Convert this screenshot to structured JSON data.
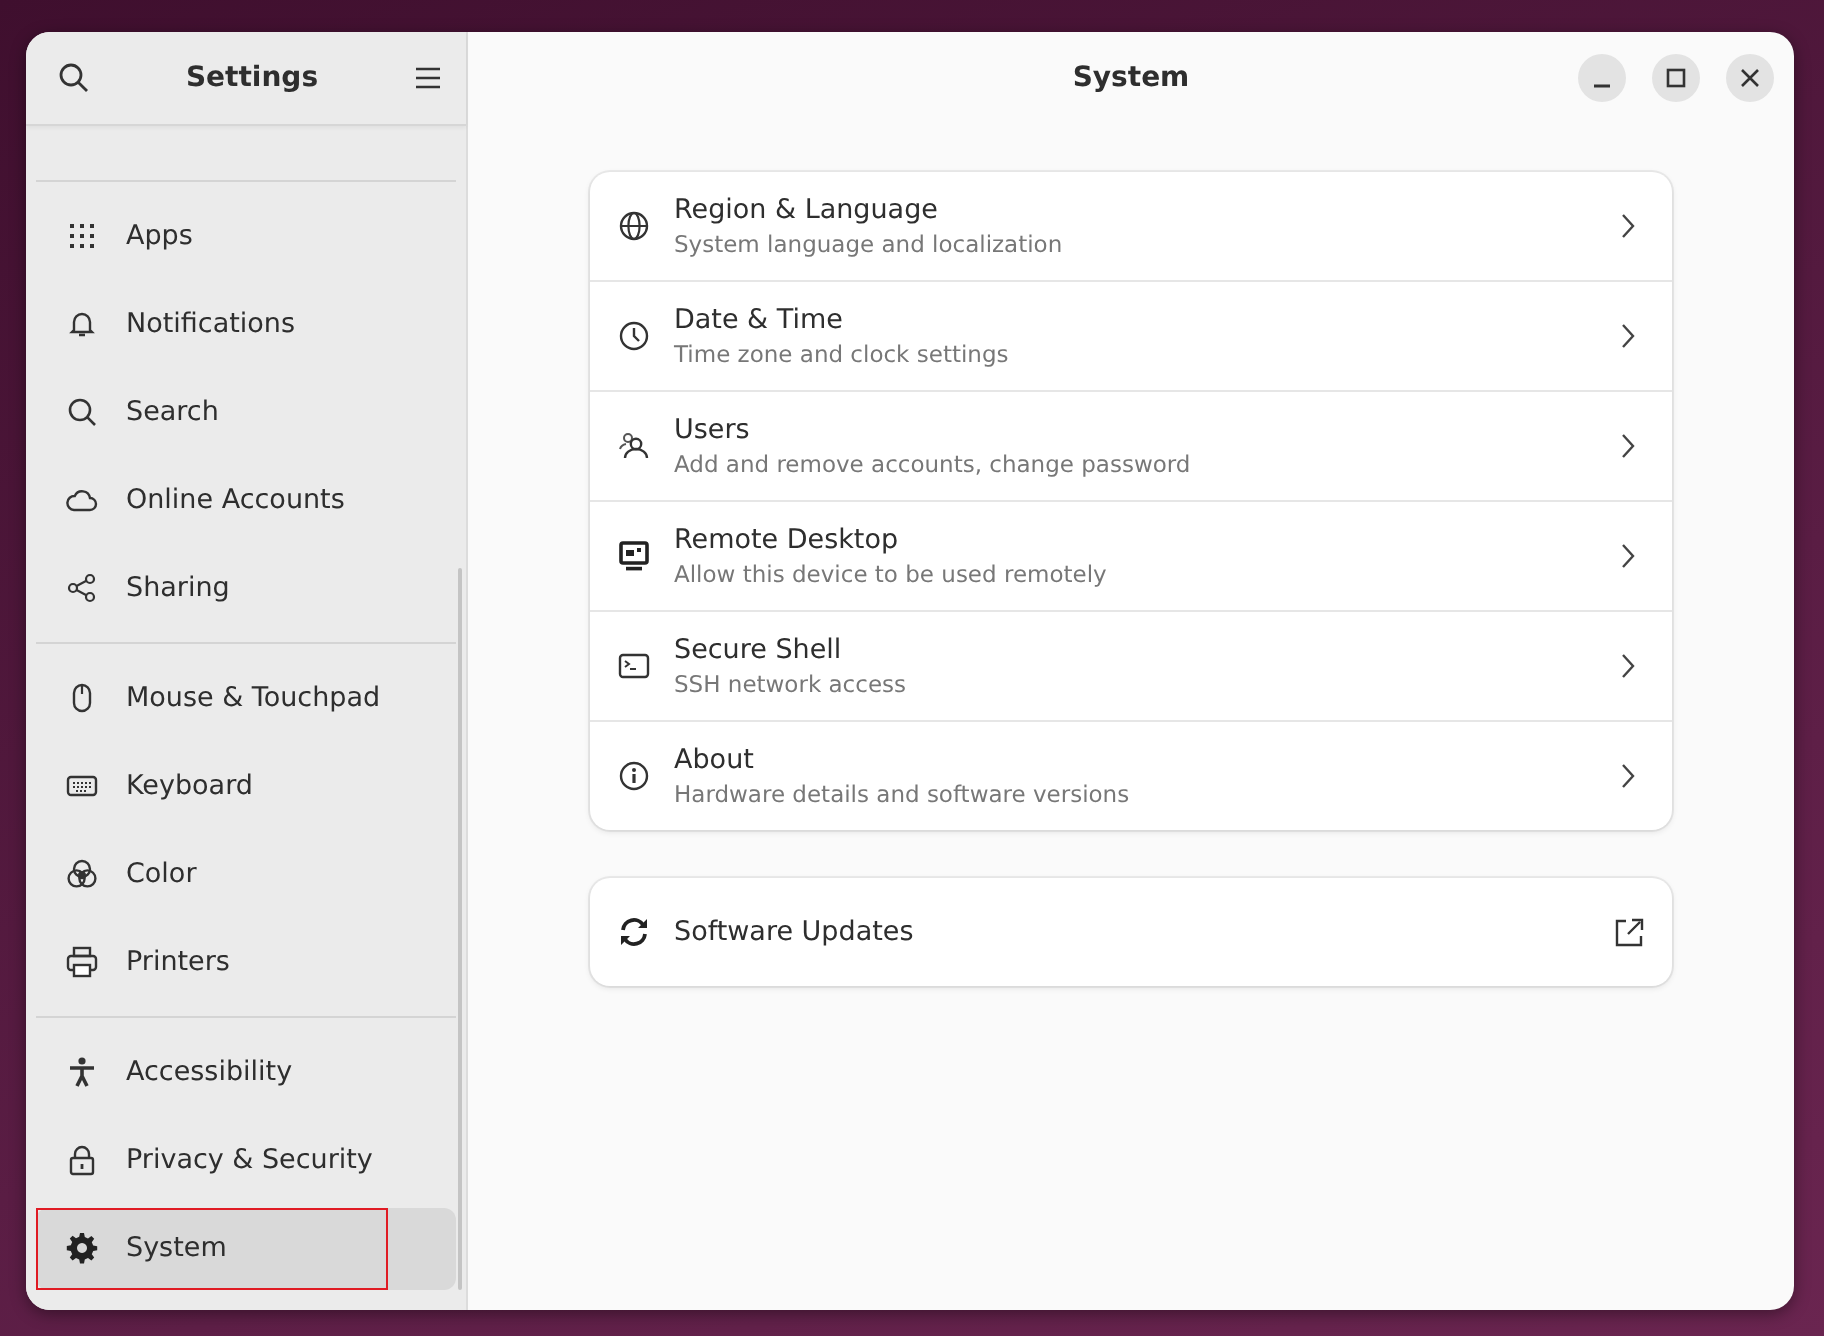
{
  "sidebar": {
    "title": "Settings",
    "groups": [
      {
        "items": [
          {
            "label": "Apps",
            "selected": false,
            "highlighted": false
          },
          {
            "label": "Notifications",
            "selected": false,
            "highlighted": false
          },
          {
            "label": "Search",
            "selected": false,
            "highlighted": false
          },
          {
            "label": "Online Accounts",
            "selected": false,
            "highlighted": false
          },
          {
            "label": "Sharing",
            "selected": false,
            "highlighted": false
          }
        ]
      },
      {
        "items": [
          {
            "label": "Mouse & Touchpad",
            "selected": false,
            "highlighted": false
          },
          {
            "label": "Keyboard",
            "selected": false,
            "highlighted": false
          },
          {
            "label": "Color",
            "selected": false,
            "highlighted": false
          },
          {
            "label": "Printers",
            "selected": false,
            "highlighted": false
          }
        ]
      },
      {
        "items": [
          {
            "label": "Accessibility",
            "selected": false,
            "highlighted": false
          },
          {
            "label": "Privacy & Security",
            "selected": false,
            "highlighted": false
          },
          {
            "label": "System",
            "selected": true,
            "highlighted": true
          }
        ]
      }
    ]
  },
  "page": {
    "title": "System",
    "rows": [
      {
        "title": "Region & Language",
        "subtitle": "System language and localization"
      },
      {
        "title": "Date & Time",
        "subtitle": "Time zone and clock settings"
      },
      {
        "title": "Users",
        "subtitle": "Add and remove accounts, change password"
      },
      {
        "title": "Remote Desktop",
        "subtitle": "Allow this device to be used remotely"
      },
      {
        "title": "Secure Shell",
        "subtitle": "SSH network access"
      },
      {
        "title": "About",
        "subtitle": "Hardware details and software versions"
      }
    ],
    "external": {
      "title": "Software Updates"
    }
  }
}
